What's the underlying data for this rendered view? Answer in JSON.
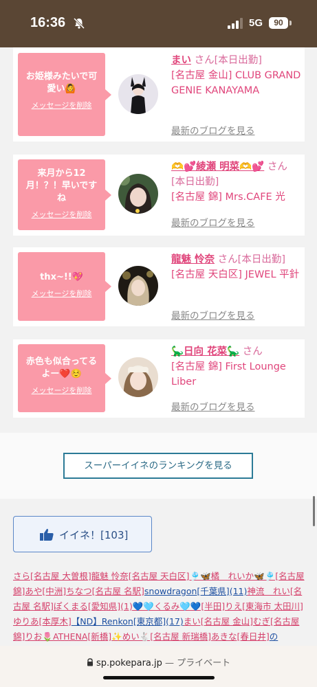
{
  "status": {
    "time": "16:36",
    "network": "5G",
    "battery": "90"
  },
  "messages": [
    {
      "text": "お姫様みたいで可愛い🙆",
      "delete_label": "メッセージを削除",
      "name": "まい",
      "honorific": "さん",
      "status": "[本日出勤]",
      "shop": "[名古屋 金山] CLUB GRAND GENIE KANAYAMA",
      "blog_label": "最新のブログを見る"
    },
    {
      "text": "来月から12月！？！早いですね",
      "delete_label": "メッセージを削除",
      "name": "🫶💕綾瀬 明菜🫶💕",
      "honorific": "さん",
      "status": "[本日出勤]",
      "shop": "[名古屋 錦] Mrs.CAFE 光",
      "blog_label": "最新のブログを見る"
    },
    {
      "text": "thx~!!💖",
      "delete_label": "メッセージを削除",
      "name": "龍魅 怜奈",
      "honorific": "さん",
      "status": "[本日出勤]",
      "shop": "[名古屋 天白区] JEWEL 平針",
      "blog_label": "最新のブログを見る"
    },
    {
      "text": "赤色も似合ってるよー❤️☺️",
      "delete_label": "メッセージを削除",
      "name": "🦕日向 花菜🦕",
      "honorific": "さん",
      "status": "",
      "shop": "[名古屋 錦] First Lounge Liber",
      "blog_label": "最新のブログを見る"
    }
  ],
  "ranking_button": "スーパーイイネのランキングを見る",
  "like_button": "イイネ！[103]",
  "liker_links": [
    {
      "text": "さら[名古屋 大曽根]",
      "color": "pink"
    },
    {
      "text": "龍魅 怜奈[名古屋 天白区]",
      "color": "pink"
    },
    {
      "text": "🎐🦋橘　れいか🦋🎐[名古屋 錦]",
      "color": "pink"
    },
    {
      "text": "あや[中洲]",
      "color": "pink"
    },
    {
      "text": "ちなつ[名古屋 名駅]",
      "color": "pink"
    },
    {
      "text": "snowdragon[千葉県](11)",
      "color": "blue"
    },
    {
      "text": "神流　れい[名古屋 名駅]",
      "color": "pink"
    },
    {
      "text": "ぽくまる[愛知県](1)",
      "color": "pink"
    },
    {
      "text": "💙🩵くるみ🩵💙[半田]",
      "color": "pink"
    },
    {
      "text": "りえ[東海市 太田川]",
      "color": "pink"
    },
    {
      "text": "ゆりあ[本厚木]",
      "color": "pink"
    },
    {
      "text": "【ND】Renkon[東京都](17)",
      "color": "blue"
    },
    {
      "text": "まい[名古屋 金山]",
      "color": "pink"
    },
    {
      "text": "むぎ[名古屋 錦]",
      "color": "pink"
    },
    {
      "text": "りお🌷ATHENA[新橋]",
      "color": "pink"
    },
    {
      "text": "✨めい🐇[名古屋 新瑞橋]",
      "color": "pink"
    },
    {
      "text": "あきな[春日井]",
      "color": "pink"
    },
    {
      "text": "の",
      "color": "blue"
    }
  ],
  "browser": {
    "domain": "sp.pokepara.jp",
    "separator": "—",
    "mode": "プライベート"
  },
  "colors": {
    "header_brown": "#5a4634",
    "bubble_pink": "#fa9aa8",
    "name_pink": "#e0457b",
    "button_teal": "#2b7a96",
    "link_blue": "#1c4ea0"
  }
}
